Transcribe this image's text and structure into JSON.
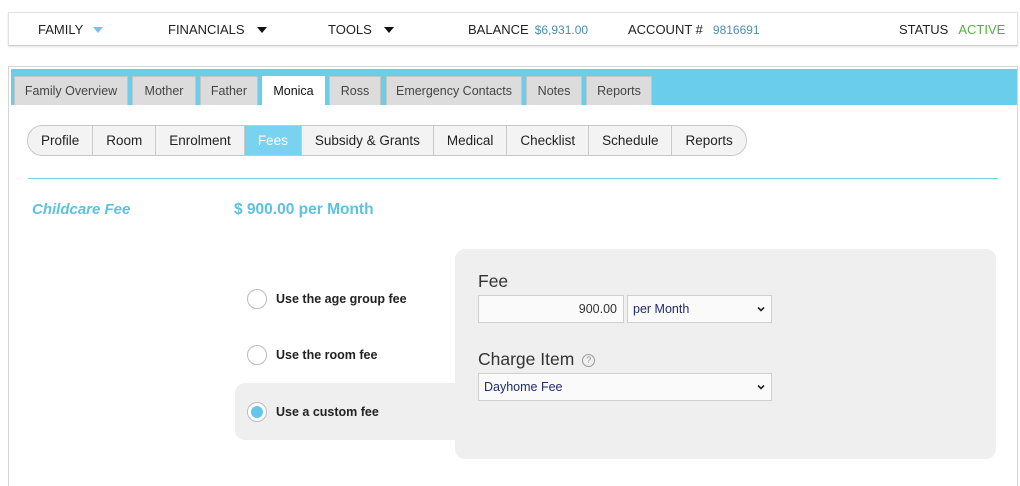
{
  "topbar": {
    "family": "FAMILY",
    "financials": "FINANCIALS",
    "tools": "TOOLS",
    "balance_label": "BALANCE",
    "balance_value": "$6,931.00",
    "account_label": "ACCOUNT #",
    "account_value": "9816691",
    "status_label": "STATUS",
    "status_value": "ACTIVE"
  },
  "tabs": [
    "Family Overview",
    "Mother",
    "Father",
    "Monica",
    "Ross",
    "Emergency Contacts",
    "Notes",
    "Reports"
  ],
  "active_tab": "Monica",
  "subtabs": [
    "Profile",
    "Room",
    "Enrolment",
    "Fees",
    "Subsidy & Grants",
    "Medical",
    "Checklist",
    "Schedule",
    "Reports"
  ],
  "active_subtab": "Fees",
  "fee": {
    "title": "Childcare Fee",
    "amount": "$ 900.00 per Month"
  },
  "options": [
    {
      "label": "Use the age group fee",
      "selected": false
    },
    {
      "label": "Use the room fee",
      "selected": false
    },
    {
      "label": "Use a custom fee",
      "selected": true
    }
  ],
  "form": {
    "fee_label": "Fee",
    "fee_value": "900.00",
    "period": "per Month",
    "charge_item_label": "Charge Item",
    "charge_item_value": "Dayhome Fee"
  },
  "colors": {
    "accent": "#6bcdec",
    "status_active": "#55b044",
    "link_value": "#4a8fb0"
  }
}
